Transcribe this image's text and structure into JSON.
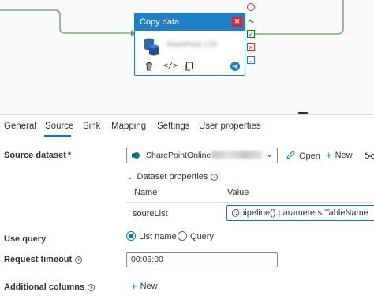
{
  "activity": {
    "title": "Copy data",
    "name_blurred": "SharePoint 2 Data"
  },
  "tabs": [
    "General",
    "Source",
    "Sink",
    "Mapping",
    "Settings",
    "User properties"
  ],
  "active_tab": "Source",
  "form": {
    "source_dataset_label": "Source dataset",
    "required_mark": "*",
    "dataset_value": "SharePointOnline",
    "open_label": "Open",
    "new_label": "New",
    "dataset_properties_label": "Dataset properties",
    "col_name": "Name",
    "col_value": "Value",
    "param_name": "soureList",
    "param_value": "@pipeline().parameters.TableName",
    "use_query_label": "Use query",
    "radio_list_name": "List name",
    "radio_query": "Query",
    "use_query_selected": "List name",
    "request_timeout_label": "Request timeout",
    "request_timeout_value": "00:05:00",
    "additional_columns_label": "Additional columns",
    "additional_new_label": "New"
  },
  "colors": {
    "accent": "#0078d4",
    "activity_header": "#1f80c6",
    "connector": "#3f8f3f",
    "error": "#d12a33",
    "success": "#107c10"
  }
}
